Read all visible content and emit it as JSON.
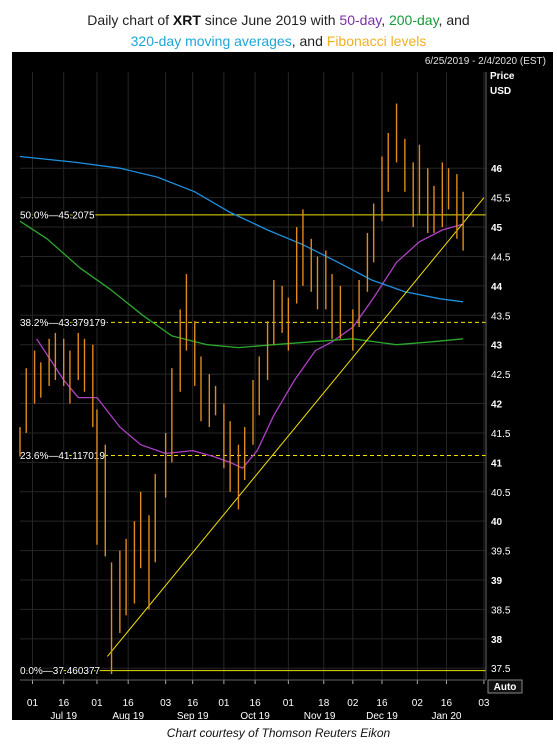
{
  "title": {
    "line1_a": "Daily chart of ",
    "symbol": "XRT",
    "line1_b": " since June 2019 with ",
    "ma50": "50-day",
    "sep1": ", ",
    "ma200": "200-day",
    "line1_c": ", and",
    "ma320": "320-day moving averages",
    "line2_b": ", and ",
    "fib": "Fibonacci levels"
  },
  "caption": "Chart courtesy of Thomson Reuters Eikon",
  "date_range": "6/25/2019 - 2/4/2020 (EST)",
  "price_label": "Price",
  "currency_label": "USD",
  "auto_label": "Auto",
  "colors": {
    "background": "#000000",
    "candles": "#e08a1e",
    "ma50": "#b040c8",
    "ma200": "#2ca82c",
    "ma320": "#1e90e0",
    "fib": "#f0e000",
    "trendline": "#f0e000",
    "grid": "#262626",
    "axis_text": "#ffffff"
  },
  "chart_data": {
    "type": "line",
    "title": "Daily chart of XRT since June 2019 with 50-day, 200-day, and 320-day moving averages, and Fibonacci levels",
    "xlabel": "",
    "ylabel": "Price USD",
    "ylim": [
      37.3,
      47.5
    ],
    "y_ticks": [
      37.5,
      38,
      38.5,
      39,
      39.5,
      40,
      40.5,
      41,
      41.5,
      42,
      42.5,
      43,
      43.5,
      44,
      44.5,
      45,
      45.5,
      46
    ],
    "y_ticks_bold": [
      38,
      39,
      40,
      41,
      42,
      43,
      44,
      45,
      46
    ],
    "x_range": [
      "2019-06-25",
      "2020-02-04"
    ],
    "x_ticks": [
      {
        "date": "2019-07-01",
        "label": "01"
      },
      {
        "date": "2019-07-16",
        "label": "16"
      },
      {
        "date": "2019-08-01",
        "label": "01"
      },
      {
        "date": "2019-08-16",
        "label": "16"
      },
      {
        "date": "2019-09-03",
        "label": "03"
      },
      {
        "date": "2019-09-16",
        "label": "16"
      },
      {
        "date": "2019-10-01",
        "label": "01"
      },
      {
        "date": "2019-10-16",
        "label": "16"
      },
      {
        "date": "2019-11-01",
        "label": "01"
      },
      {
        "date": "2019-11-18",
        "label": "18"
      },
      {
        "date": "2019-12-02",
        "label": "02"
      },
      {
        "date": "2019-12-16",
        "label": "16"
      },
      {
        "date": "2020-01-02",
        "label": "02"
      },
      {
        "date": "2020-01-16",
        "label": "16"
      },
      {
        "date": "2020-02-03",
        "label": "03"
      }
    ],
    "month_labels": [
      {
        "date": "2019-07-16",
        "label": "Jul 19"
      },
      {
        "date": "2019-08-16",
        "label": "Aug 19"
      },
      {
        "date": "2019-09-16",
        "label": "Sep 19"
      },
      {
        "date": "2019-10-16",
        "label": "Oct 19"
      },
      {
        "date": "2019-11-16",
        "label": "Nov 19"
      },
      {
        "date": "2019-12-16",
        "label": "Dec 19"
      },
      {
        "date": "2020-01-16",
        "label": "Jan 20"
      }
    ],
    "fib_levels": [
      {
        "label": "50.0%",
        "value": 45.2075,
        "style": "solid"
      },
      {
        "label": "38.2%",
        "value": 43.379179,
        "style": "dashed"
      },
      {
        "label": "23.6%",
        "value": 41.117019,
        "style": "dashed"
      },
      {
        "label": "0.0%",
        "value": 37.460377,
        "style": "solid"
      }
    ],
    "trendline": {
      "from": {
        "x": "2019-08-06",
        "y": 37.7
      },
      "to": {
        "x": "2020-02-03",
        "y": 45.5
      }
    },
    "series": [
      {
        "name": "Daily price bars",
        "kind": "bars",
        "points": [
          {
            "x": "2019-06-25",
            "h": 41.6,
            "l": 41.1
          },
          {
            "x": "2019-06-28",
            "h": 42.6,
            "l": 41.5
          },
          {
            "x": "2019-07-02",
            "h": 42.9,
            "l": 42.0
          },
          {
            "x": "2019-07-05",
            "h": 42.7,
            "l": 42.1
          },
          {
            "x": "2019-07-09",
            "h": 43.1,
            "l": 42.3
          },
          {
            "x": "2019-07-12",
            "h": 43.2,
            "l": 42.4
          },
          {
            "x": "2019-07-16",
            "h": 43.1,
            "l": 42.3
          },
          {
            "x": "2019-07-19",
            "h": 42.9,
            "l": 42.0
          },
          {
            "x": "2019-07-23",
            "h": 43.2,
            "l": 42.4
          },
          {
            "x": "2019-07-26",
            "h": 43.1,
            "l": 42.2
          },
          {
            "x": "2019-07-30",
            "h": 43.0,
            "l": 41.6
          },
          {
            "x": "2019-08-01",
            "h": 41.9,
            "l": 39.6
          },
          {
            "x": "2019-08-05",
            "h": 41.3,
            "l": 39.4
          },
          {
            "x": "2019-08-08",
            "h": 39.3,
            "l": 37.4
          },
          {
            "x": "2019-08-12",
            "h": 39.5,
            "l": 38.1
          },
          {
            "x": "2019-08-15",
            "h": 39.7,
            "l": 38.4
          },
          {
            "x": "2019-08-19",
            "h": 40.0,
            "l": 38.6
          },
          {
            "x": "2019-08-22",
            "h": 40.5,
            "l": 39.2
          },
          {
            "x": "2019-08-26",
            "h": 40.1,
            "l": 38.5
          },
          {
            "x": "2019-08-29",
            "h": 40.8,
            "l": 39.3
          },
          {
            "x": "2019-09-03",
            "h": 41.5,
            "l": 40.4
          },
          {
            "x": "2019-09-06",
            "h": 42.6,
            "l": 41.0
          },
          {
            "x": "2019-09-10",
            "h": 43.6,
            "l": 42.2
          },
          {
            "x": "2019-09-13",
            "h": 44.2,
            "l": 42.9
          },
          {
            "x": "2019-09-17",
            "h": 43.4,
            "l": 42.3
          },
          {
            "x": "2019-09-20",
            "h": 42.8,
            "l": 41.7
          },
          {
            "x": "2019-09-24",
            "h": 42.5,
            "l": 41.6
          },
          {
            "x": "2019-09-27",
            "h": 42.3,
            "l": 41.8
          },
          {
            "x": "2019-10-01",
            "h": 42.0,
            "l": 40.9
          },
          {
            "x": "2019-10-04",
            "h": 41.7,
            "l": 40.5
          },
          {
            "x": "2019-10-08",
            "h": 41.3,
            "l": 40.2
          },
          {
            "x": "2019-10-11",
            "h": 41.6,
            "l": 40.7
          },
          {
            "x": "2019-10-15",
            "h": 42.4,
            "l": 41.3
          },
          {
            "x": "2019-10-18",
            "h": 42.8,
            "l": 41.8
          },
          {
            "x": "2019-10-22",
            "h": 43.4,
            "l": 42.4
          },
          {
            "x": "2019-10-25",
            "h": 44.1,
            "l": 43.0
          },
          {
            "x": "2019-10-29",
            "h": 44.0,
            "l": 43.2
          },
          {
            "x": "2019-11-01",
            "h": 43.8,
            "l": 42.9
          },
          {
            "x": "2019-11-05",
            "h": 45.0,
            "l": 43.7
          },
          {
            "x": "2019-11-08",
            "h": 45.3,
            "l": 44.0
          },
          {
            "x": "2019-11-12",
            "h": 44.8,
            "l": 43.9
          },
          {
            "x": "2019-11-15",
            "h": 44.5,
            "l": 43.6
          },
          {
            "x": "2019-11-19",
            "h": 44.6,
            "l": 43.6
          },
          {
            "x": "2019-11-22",
            "h": 44.2,
            "l": 43.1
          },
          {
            "x": "2019-11-26",
            "h": 44.0,
            "l": 43.1
          },
          {
            "x": "2019-12-02",
            "h": 43.6,
            "l": 42.9
          },
          {
            "x": "2019-12-05",
            "h": 44.1,
            "l": 43.3
          },
          {
            "x": "2019-12-09",
            "h": 44.9,
            "l": 43.9
          },
          {
            "x": "2019-12-12",
            "h": 45.4,
            "l": 44.4
          },
          {
            "x": "2019-12-16",
            "h": 46.2,
            "l": 45.1
          },
          {
            "x": "2019-12-19",
            "h": 46.6,
            "l": 45.6
          },
          {
            "x": "2019-12-23",
            "h": 47.1,
            "l": 46.1
          },
          {
            "x": "2019-12-27",
            "h": 46.5,
            "l": 45.6
          },
          {
            "x": "2019-12-31",
            "h": 46.1,
            "l": 45.0
          },
          {
            "x": "2020-01-03",
            "h": 46.4,
            "l": 45.2
          },
          {
            "x": "2020-01-07",
            "h": 46.0,
            "l": 44.9
          },
          {
            "x": "2020-01-10",
            "h": 45.7,
            "l": 44.9
          },
          {
            "x": "2020-01-14",
            "h": 46.1,
            "l": 45.0
          },
          {
            "x": "2020-01-17",
            "h": 46.0,
            "l": 45.3
          },
          {
            "x": "2020-01-21",
            "h": 45.9,
            "l": 44.8
          },
          {
            "x": "2020-01-24",
            "h": 45.6,
            "l": 44.6
          }
        ]
      },
      {
        "name": "50-day",
        "kind": "line",
        "points": [
          {
            "x": "2019-07-03",
            "y": 43.1
          },
          {
            "x": "2019-07-16",
            "y": 42.4
          },
          {
            "x": "2019-07-23",
            "y": 42.1
          },
          {
            "x": "2019-08-01",
            "y": 42.1
          },
          {
            "x": "2019-08-12",
            "y": 41.6
          },
          {
            "x": "2019-08-22",
            "y": 41.3
          },
          {
            "x": "2019-09-03",
            "y": 41.15
          },
          {
            "x": "2019-09-16",
            "y": 41.2
          },
          {
            "x": "2019-09-26",
            "y": 41.1
          },
          {
            "x": "2019-10-04",
            "y": 41.0
          },
          {
            "x": "2019-10-10",
            "y": 40.9
          },
          {
            "x": "2019-10-17",
            "y": 41.2
          },
          {
            "x": "2019-10-25",
            "y": 41.8
          },
          {
            "x": "2019-11-04",
            "y": 42.4
          },
          {
            "x": "2019-11-14",
            "y": 42.9
          },
          {
            "x": "2019-11-22",
            "y": 43.05
          },
          {
            "x": "2019-12-02",
            "y": 43.3
          },
          {
            "x": "2019-12-12",
            "y": 43.8
          },
          {
            "x": "2019-12-23",
            "y": 44.4
          },
          {
            "x": "2020-01-03",
            "y": 44.75
          },
          {
            "x": "2020-01-14",
            "y": 44.95
          },
          {
            "x": "2020-01-24",
            "y": 45.05
          }
        ]
      },
      {
        "name": "200-day",
        "kind": "line",
        "points": [
          {
            "x": "2019-06-25",
            "y": 45.1
          },
          {
            "x": "2019-07-08",
            "y": 44.8
          },
          {
            "x": "2019-07-24",
            "y": 44.3
          },
          {
            "x": "2019-08-07",
            "y": 43.95
          },
          {
            "x": "2019-08-23",
            "y": 43.5
          },
          {
            "x": "2019-09-06",
            "y": 43.15
          },
          {
            "x": "2019-09-23",
            "y": 43.0
          },
          {
            "x": "2019-10-08",
            "y": 42.95
          },
          {
            "x": "2019-10-25",
            "y": 43.0
          },
          {
            "x": "2019-11-12",
            "y": 43.05
          },
          {
            "x": "2019-12-02",
            "y": 43.1
          },
          {
            "x": "2019-12-23",
            "y": 43.0
          },
          {
            "x": "2020-01-09",
            "y": 43.05
          },
          {
            "x": "2020-01-24",
            "y": 43.1
          }
        ]
      },
      {
        "name": "320-day",
        "kind": "line",
        "points": [
          {
            "x": "2019-06-25",
            "y": 46.2
          },
          {
            "x": "2019-07-22",
            "y": 46.1
          },
          {
            "x": "2019-08-12",
            "y": 46.0
          },
          {
            "x": "2019-08-30",
            "y": 45.85
          },
          {
            "x": "2019-09-17",
            "y": 45.6
          },
          {
            "x": "2019-10-04",
            "y": 45.25
          },
          {
            "x": "2019-10-22",
            "y": 44.95
          },
          {
            "x": "2019-11-08",
            "y": 44.7
          },
          {
            "x": "2019-11-25",
            "y": 44.4
          },
          {
            "x": "2019-12-11",
            "y": 44.1
          },
          {
            "x": "2019-12-27",
            "y": 43.9
          },
          {
            "x": "2020-01-13",
            "y": 43.78
          },
          {
            "x": "2020-01-24",
            "y": 43.73
          }
        ]
      }
    ]
  }
}
